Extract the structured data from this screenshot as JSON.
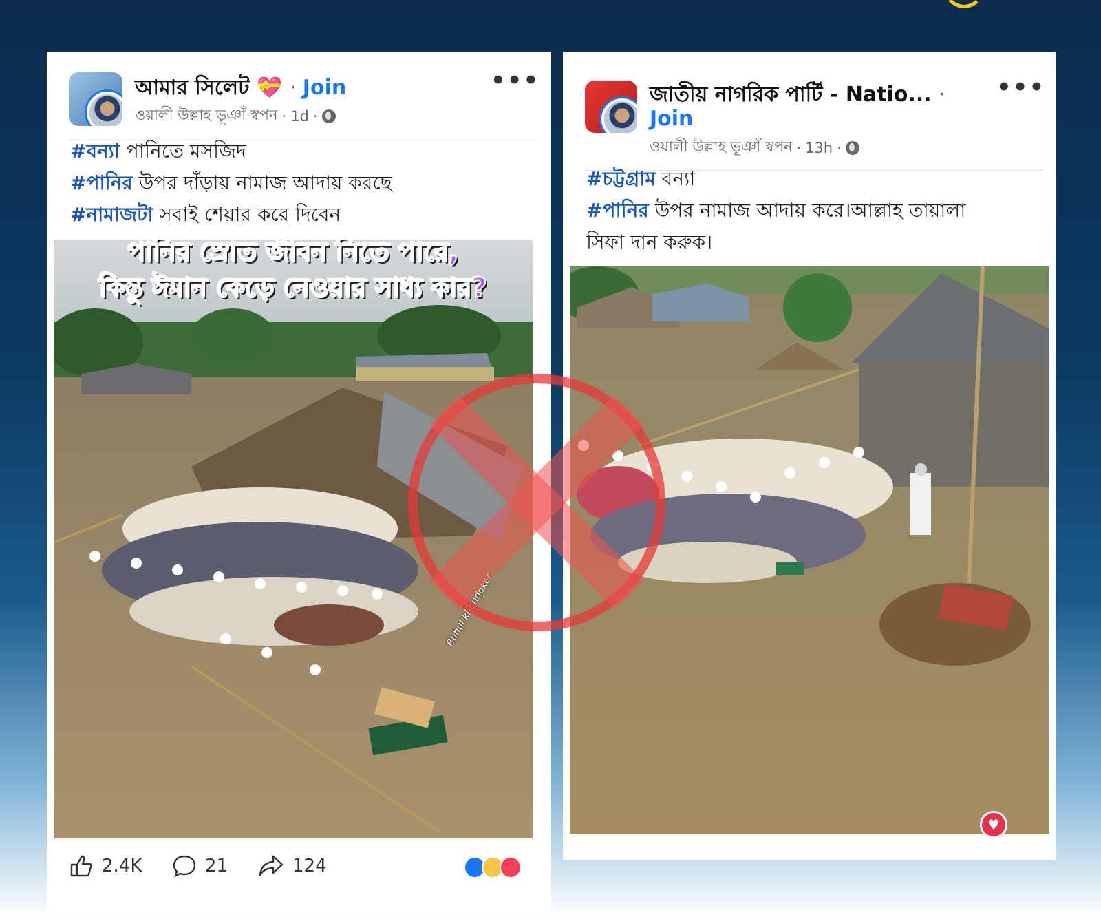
{
  "left_post": {
    "group_name": "আমার সিলেট 💝",
    "join_label": "Join",
    "author": "ওয়ালী উল্লাহ ভূঞাঁ স্বপন",
    "time": "1d",
    "more": "•••",
    "lines": [
      {
        "tag": "#বন্যা",
        "text": " পানিতে মসজিদ"
      },
      {
        "tag": "#পানির",
        "text": " উপর দাঁড়ায় নামাজ আদায় করছে"
      },
      {
        "tag": "#নামাজটা",
        "text": " সবাই শেয়ার করে দিবেন"
      }
    ],
    "image_caption_line1": "পানির স্রোত জীবন নিতে পারে,",
    "image_caption_line2": "কিন্তু ঈমান কেড়ে নেওয়ার সাধ্য কার?",
    "watermark": "Ruhul khondoker",
    "likes": "2.4K",
    "comments": "21",
    "shares": "124"
  },
  "right_post": {
    "group_name": "জাতীয় নাগরিক পার্টি - Natio...",
    "join_label": "Join",
    "author": "ওয়ালী উল্লাহ ভূঞাঁ স্বপন",
    "time": "13h",
    "more": "•••",
    "lines": [
      {
        "tag": "#চট্টগ্রাম",
        "text": " বন্যা"
      },
      {
        "tag": "#পানির",
        "text": " উপর নামাজ আদায় করে।আল্লাহ তায়ালা"
      },
      {
        "tag": "",
        "text": "সিফা দান করুক।"
      }
    ]
  },
  "icons": {
    "globe": "globe-icon",
    "like": "like-icon",
    "comment": "comment-icon",
    "share": "share-icon",
    "fake_mark": "cross-mark-icon",
    "heart": "heart-icon"
  },
  "colors": {
    "join": "#1877f2",
    "hashtag": "#1a56b8",
    "fake_mark": "#e53935"
  }
}
